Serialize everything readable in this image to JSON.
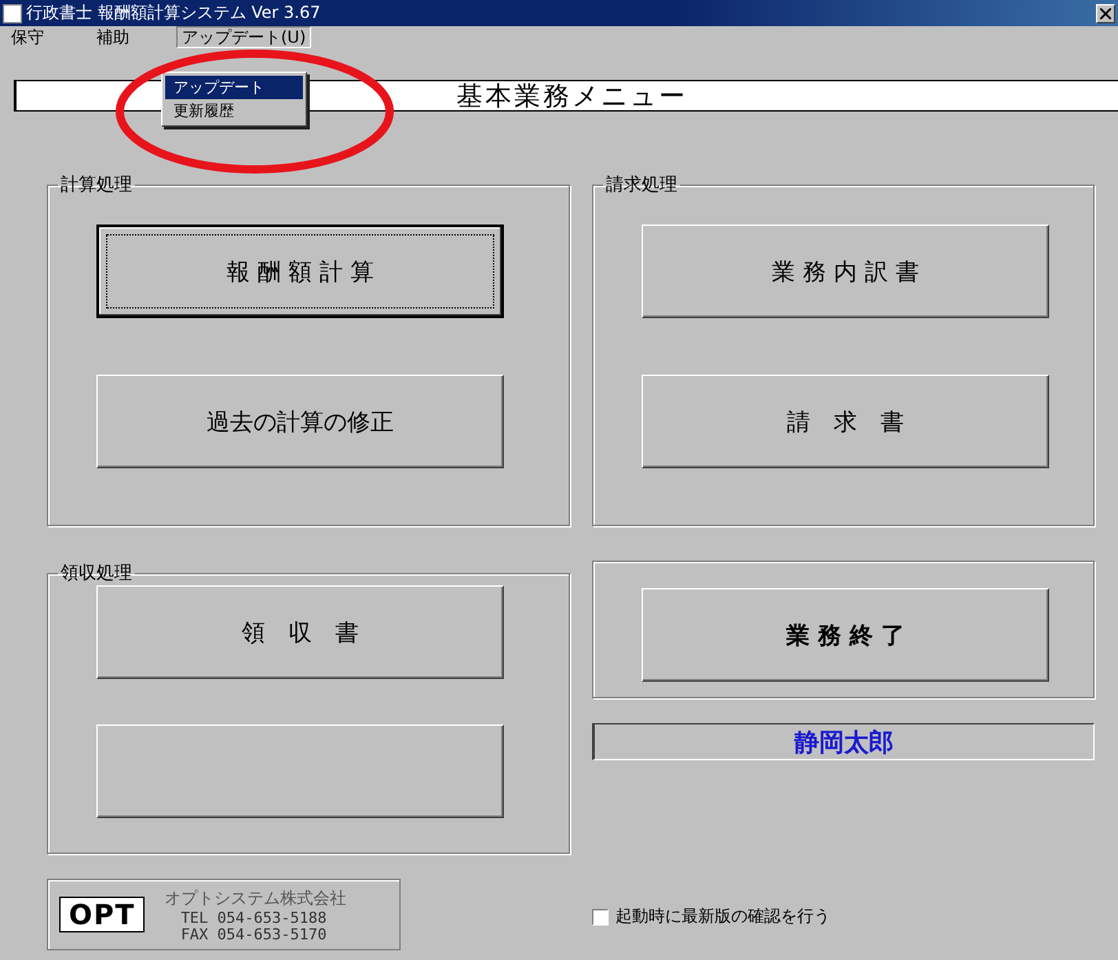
{
  "window": {
    "title": "行政書士 報酬額計算システム Ver 3.67"
  },
  "menu": [
    {
      "label": "保守",
      "open": false
    },
    {
      "label": "補助",
      "open": false
    },
    {
      "label": "アップデート(U)",
      "open": true,
      "items": [
        {
          "label": "アップデート",
          "selected": true
        },
        {
          "label": "更新履歴",
          "selected": false
        }
      ]
    }
  ],
  "header": "基本業務メニュー",
  "groups": [
    {
      "title": "計算処理",
      "buttons": [
        {
          "label": "報 酬 額 計 算",
          "focused": true
        },
        {
          "label": "過去の計算の修正",
          "focused": false
        }
      ]
    },
    {
      "title": "領収処理",
      "buttons": [
        {
          "label": "領　収　書",
          "focused": false
        },
        {
          "focused": false
        }
      ]
    },
    {
      "title": "請求処理",
      "buttons": [
        {
          "label": "業 務 内 訳 書",
          "focused": false
        },
        {
          "label": "請　求　書",
          "focused": false
        }
      ]
    }
  ],
  "exit_button": {
    "label": "業 務 終 了"
  },
  "user_name": "静岡太郎",
  "startup_check": {
    "label": "起動時に最新版の確認を行う",
    "checked": false
  },
  "company": {
    "logo": "OPT",
    "name": "オプトシステム株式会社",
    "tel": "TEL 054-653-5188",
    "fax": "FAX 054-653-5170"
  },
  "annotation": {
    "kind": "ellipse",
    "color": "#e8141c"
  }
}
